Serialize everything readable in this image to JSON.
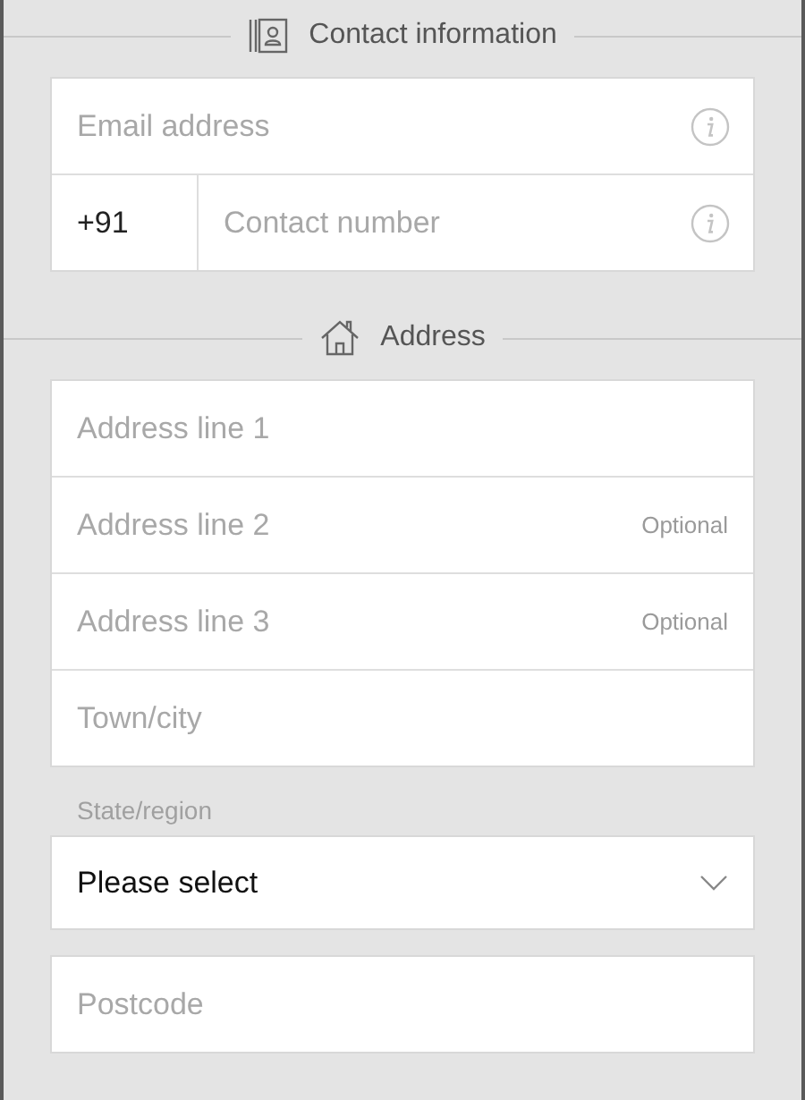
{
  "contact_section": {
    "title": "Contact information",
    "fields": [
      {
        "placeholder": "Email address",
        "info": true
      },
      {
        "prefix": "+91",
        "placeholder": "Contact number",
        "info": true
      }
    ]
  },
  "address_section": {
    "title": "Address",
    "fields": [
      {
        "placeholder": "Address line 1"
      },
      {
        "placeholder": "Address line 2",
        "hint": "Optional"
      },
      {
        "placeholder": "Address line 3",
        "hint": "Optional"
      },
      {
        "placeholder": "Town/city"
      }
    ]
  },
  "state_select": {
    "label": "State/region",
    "value": "Please select"
  },
  "postcode": {
    "placeholder": "Postcode"
  }
}
